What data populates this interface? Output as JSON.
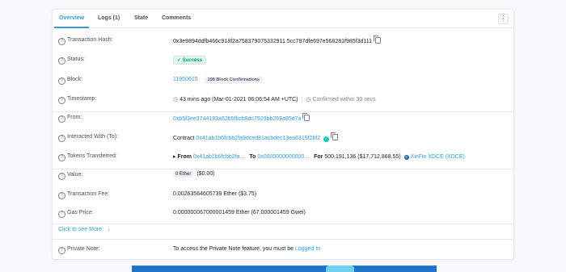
{
  "tabs": [
    {
      "label": "Overview",
      "active": true
    },
    {
      "label": "Logs (1)",
      "active": false
    },
    {
      "label": "State",
      "active": false
    },
    {
      "label": "Comments",
      "active": false
    }
  ],
  "menu_icon": "more-vertical-icon",
  "rows": {
    "tx_hash": {
      "label": "Transaction Hash:",
      "value": "0x3e9894ddfb466c918f2a758379075332911 5cc787dfe697e568281f985f3d111"
    },
    "status": {
      "label": "Status:",
      "value": "Success"
    },
    "block": {
      "label": "Block:",
      "value": "11950615",
      "confirmations": "198 Block Confirmations"
    },
    "timestamp": {
      "label": "Timestamp:",
      "value": "43 mins ago (Mar-01-2021 06:06:54 AM +UTC)",
      "confirmed": "Confirmed within 30 secs"
    },
    "from": {
      "label": "From:",
      "value": "0xb5f3ee3744183a62b5fbcb8dc7929bb269a95d7a"
    },
    "interacted": {
      "label": "Interacted With (To):",
      "prefix": "Contract",
      "value": "0x41ab1b6fcbb2fa9dced81acbdec13ea6315f2bf2"
    },
    "tokens": {
      "label": "Tokens Transferred:",
      "from_label": "From",
      "from_value": "0x41ab1b6fcbb2fa...",
      "to_label": "To",
      "to_value": "0x0000000000000...",
      "for_label": "For",
      "amount": "500,191,136",
      "usd": "($17,712,868.55)",
      "token": "XinFin XDCE (XDCE)"
    },
    "value": {
      "label": "Value:",
      "ether": "0 Ether",
      "usd": "($0.00)"
    },
    "fee": {
      "label": "Transaction Fee:",
      "value": "0.00263564605739 Ether ($3.75)"
    },
    "gas": {
      "label": "Gas Price:",
      "value": "0.000000067000001459 Ether (67.000001459 Gwei)"
    }
  },
  "see_more": "Click to see More",
  "private_note": {
    "label": "Private Note:",
    "text": "To access the Private Note feature, you must be",
    "link": "Logged In"
  },
  "colors": {
    "accent": "#3498db",
    "success": "#00c9a7",
    "border": "#e7eaf3"
  }
}
